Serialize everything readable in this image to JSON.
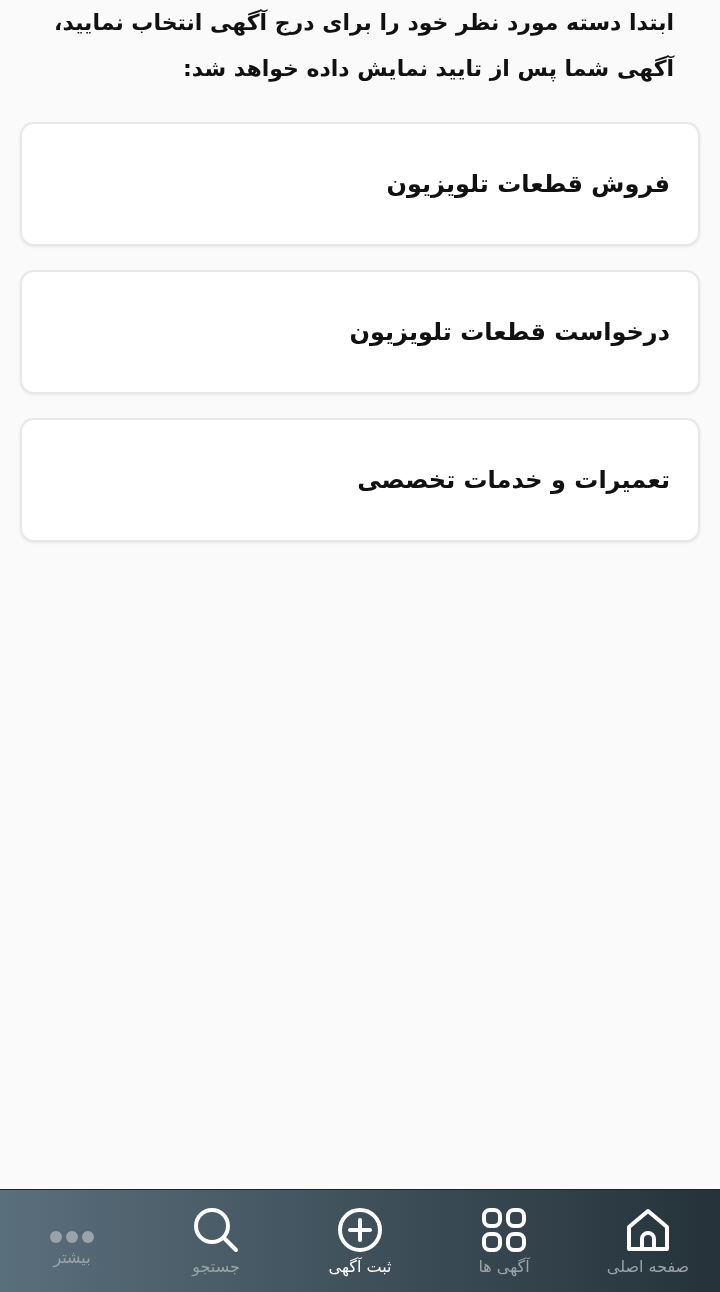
{
  "intro": "ابتدا دسته مورد نظر خود را برای درج آگهی انتخاب نمایید، آگهی شما پس از تایید نمایش داده خواهد شد:",
  "categories": [
    "فروش قطعات تلویزیون",
    "درخواست قطعات تلویزیون",
    "تعمیرات و خدمات تخصصی"
  ],
  "nav": [
    {
      "kind": "home",
      "label": "صفحه اصلی",
      "selected": false,
      "disabled": false
    },
    {
      "kind": "grid",
      "label": "آگهی ها",
      "selected": false,
      "disabled": false
    },
    {
      "kind": "add",
      "label": "ثبت آگهی",
      "selected": true,
      "disabled": false
    },
    {
      "kind": "search",
      "label": "جستجو",
      "selected": false,
      "disabled": false
    },
    {
      "kind": "more",
      "label": "بیشتر",
      "selected": false,
      "disabled": true
    }
  ]
}
